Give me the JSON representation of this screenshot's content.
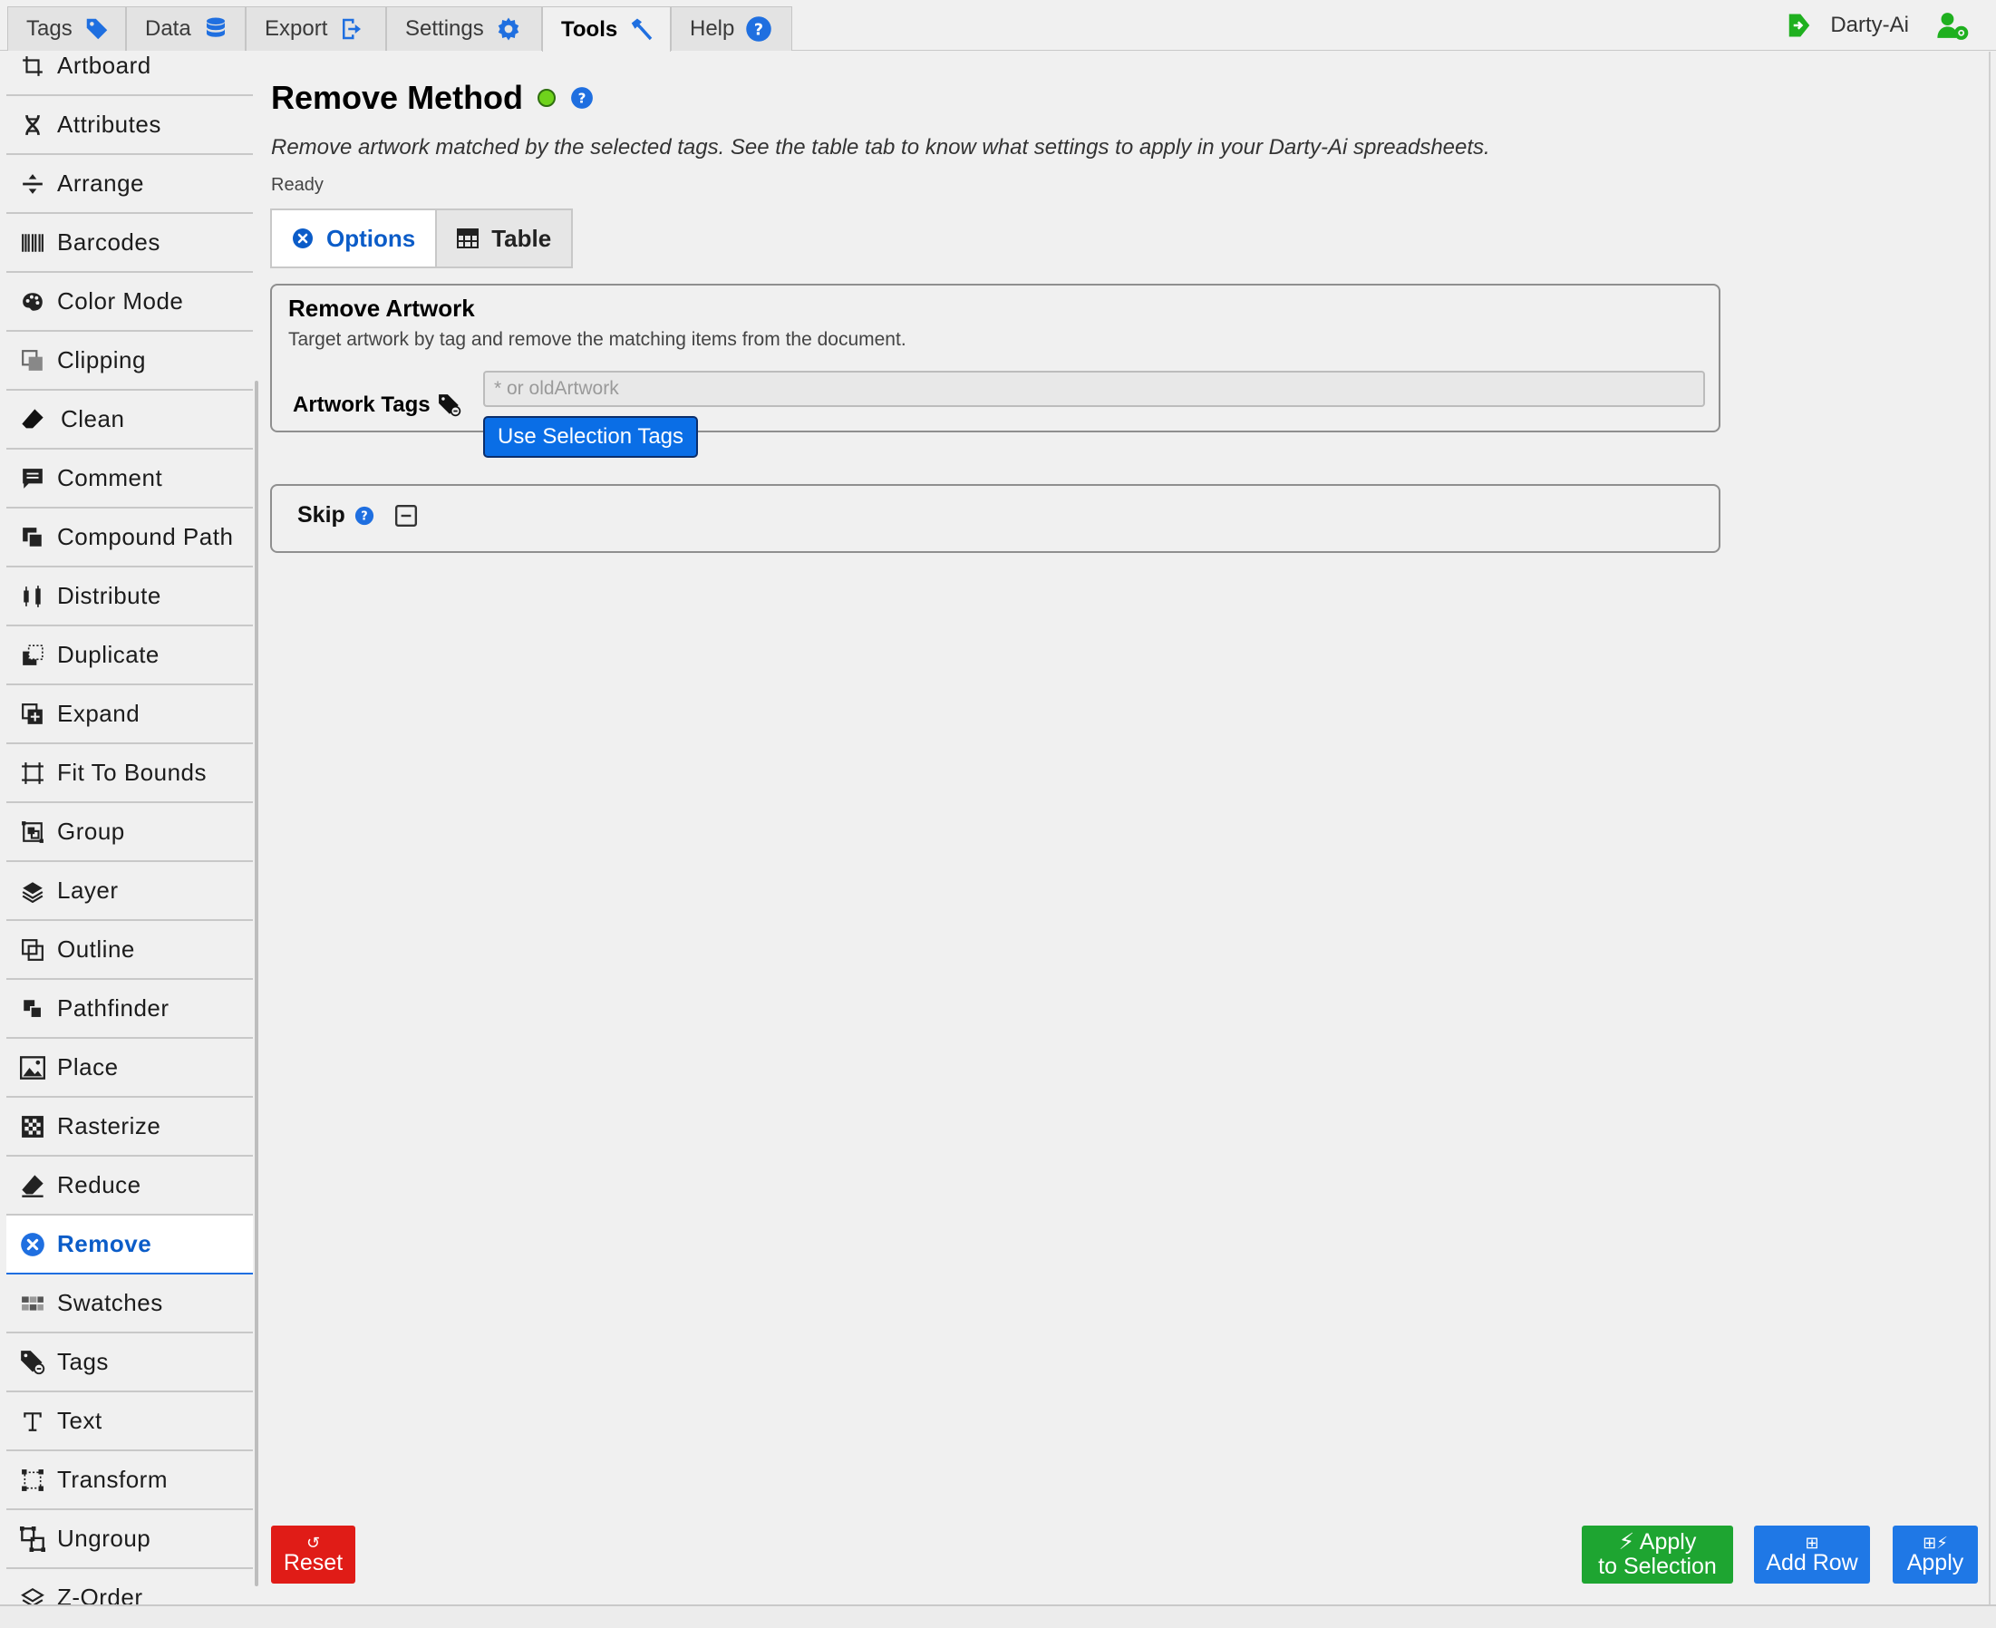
{
  "top_tabs": [
    {
      "label": "Tags",
      "icon": "tag-icon"
    },
    {
      "label": "Data",
      "icon": "database-icon"
    },
    {
      "label": "Export",
      "icon": "export-icon"
    },
    {
      "label": "Settings",
      "icon": "gear-icon"
    },
    {
      "label": "Tools",
      "icon": "hammer-icon",
      "active": true
    },
    {
      "label": "Help",
      "icon": "help-icon"
    }
  ],
  "user": {
    "name": "Darty-Ai"
  },
  "sidebar": {
    "items": [
      {
        "label": "Artboard"
      },
      {
        "label": "Attributes"
      },
      {
        "label": "Arrange"
      },
      {
        "label": "Barcodes"
      },
      {
        "label": "Color Mode"
      },
      {
        "label": "Clipping"
      },
      {
        "label": "Clean"
      },
      {
        "label": "Comment"
      },
      {
        "label": "Compound Path"
      },
      {
        "label": "Distribute"
      },
      {
        "label": "Duplicate"
      },
      {
        "label": "Expand"
      },
      {
        "label": "Fit To Bounds"
      },
      {
        "label": "Group"
      },
      {
        "label": "Layer"
      },
      {
        "label": "Outline"
      },
      {
        "label": "Pathfinder"
      },
      {
        "label": "Place"
      },
      {
        "label": "Rasterize"
      },
      {
        "label": "Reduce"
      },
      {
        "label": "Remove",
        "active": true
      },
      {
        "label": "Swatches"
      },
      {
        "label": "Tags"
      },
      {
        "label": "Text"
      },
      {
        "label": "Transform"
      },
      {
        "label": "Ungroup"
      },
      {
        "label": "Z-Order"
      }
    ]
  },
  "main": {
    "title": "Remove Method",
    "description": "Remove artwork matched by the selected tags. See the table tab to know what settings to apply in your Darty-Ai spreadsheets.",
    "status": "Ready",
    "tabs": [
      {
        "label": "Options",
        "active": true
      },
      {
        "label": "Table"
      }
    ],
    "remove_panel": {
      "title": "Remove Artwork",
      "description": "Target artwork by tag and remove the matching items from the document.",
      "field_label": "Artwork Tags",
      "input_value": "",
      "input_placeholder": "* or oldArtwork",
      "button_label": "Use Selection Tags"
    },
    "skip_panel": {
      "label": "Skip"
    }
  },
  "footer": {
    "reset_label": "Reset",
    "apply_selection_line1": "Apply",
    "apply_selection_line2": "to Selection",
    "add_row_label": "Add Row",
    "apply_label": "Apply"
  },
  "colors": {
    "accent": "#0a6ee6",
    "status_ready": "#6fd31c",
    "reset": "#e01c17",
    "apply_selection": "#1ea531",
    "user_green": "#1fb01f"
  }
}
